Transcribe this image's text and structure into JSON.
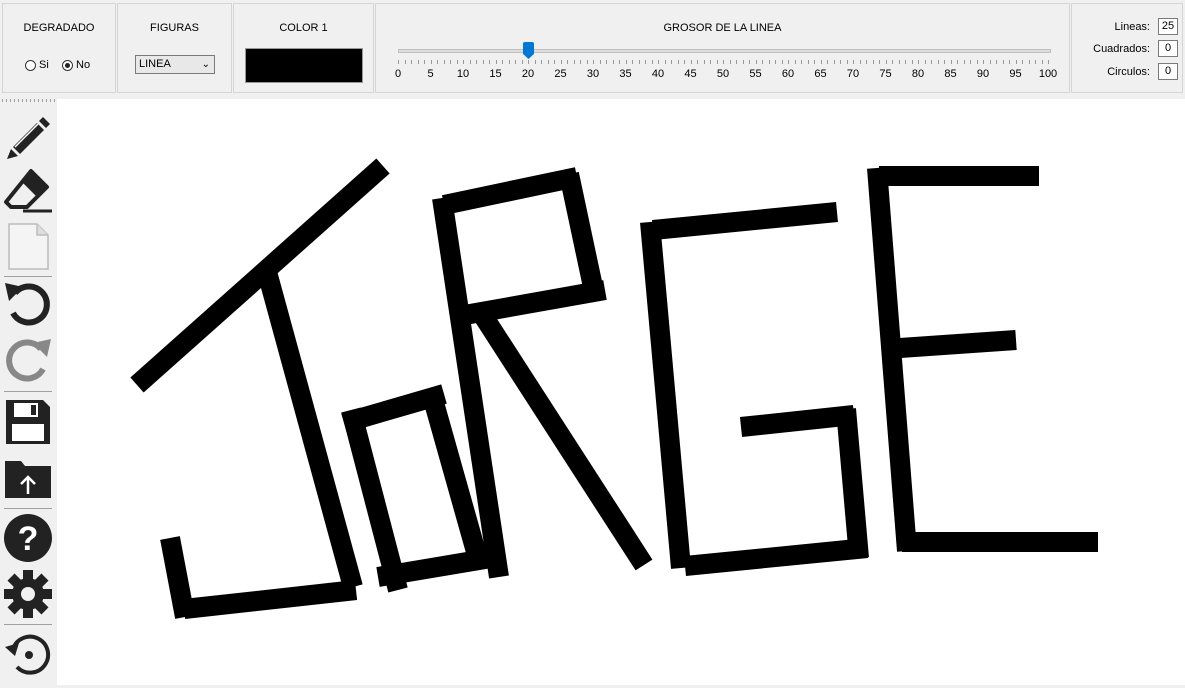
{
  "toolbar": {
    "degradado": {
      "title": "DEGRADADO",
      "option_si": "Si",
      "option_no": "No",
      "selected": "No"
    },
    "figuras": {
      "title": "FIGURAS",
      "selected": "LINEA"
    },
    "color": {
      "title": "COLOR 1",
      "value": "#000000"
    },
    "grosor": {
      "title": "GROSOR DE LA LINEA",
      "value": 20,
      "ticks": [
        "0",
        "5",
        "10",
        "15",
        "20",
        "25",
        "30",
        "35",
        "40",
        "45",
        "50",
        "55",
        "60",
        "65",
        "70",
        "75",
        "80",
        "85",
        "90",
        "95",
        "100"
      ]
    },
    "stats": {
      "lineas_label": "Lineas:",
      "lineas": "25",
      "cuadrados_label": "Cuadrados:",
      "cuadrados": "0",
      "circulos_label": "Circulos:",
      "circulos": "0"
    }
  },
  "sidebar": {
    "tools": [
      "pencil-icon",
      "eraser-icon",
      "new-file-icon",
      "undo-icon",
      "redo-icon",
      "save-icon",
      "open-folder-icon",
      "help-icon",
      "settings-icon",
      "history-icon"
    ]
  },
  "canvas": {
    "stroke_color": "#000000"
  }
}
